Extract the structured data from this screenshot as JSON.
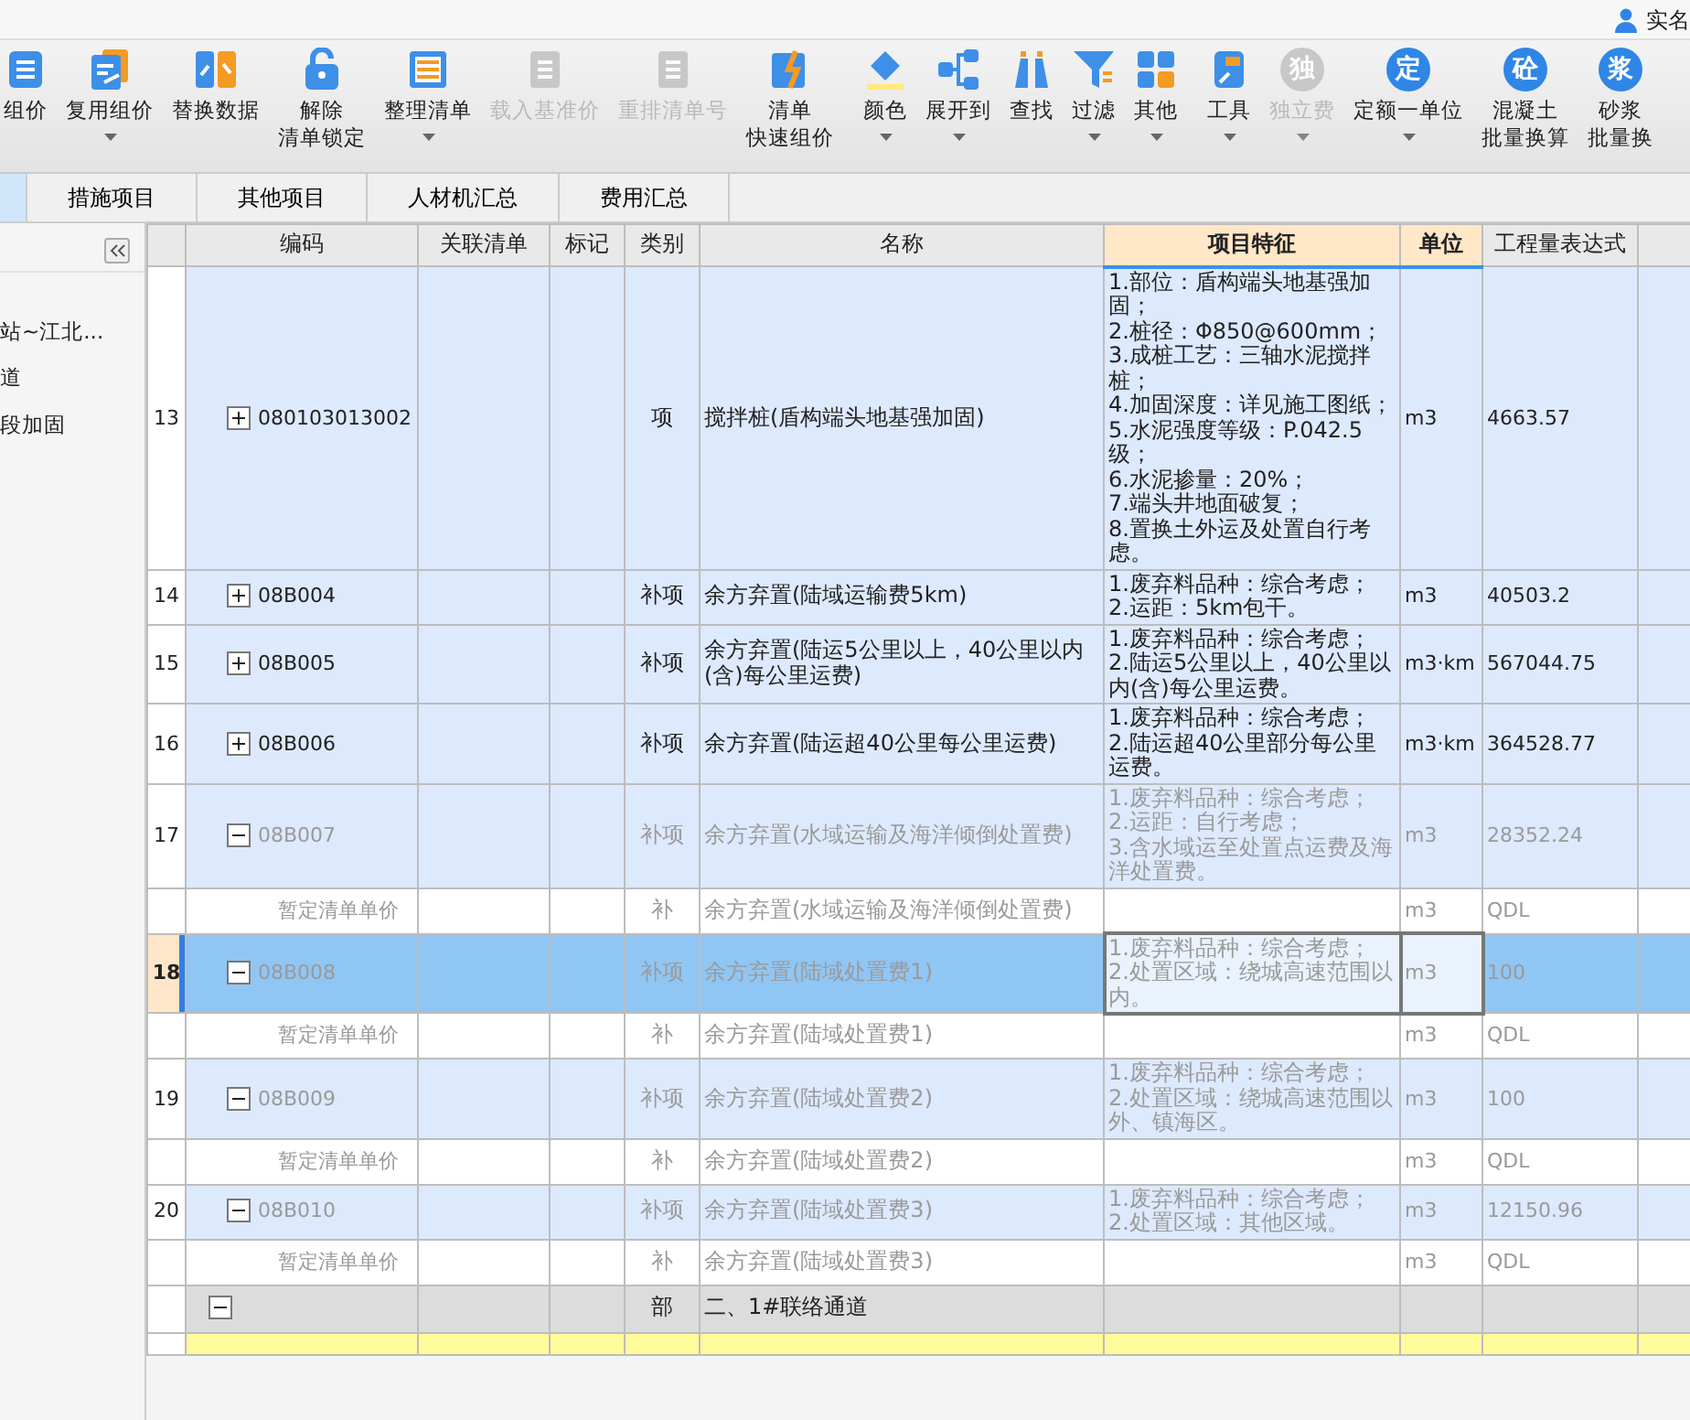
{
  "top_bar": {
    "user": "实名"
  },
  "toolbar": [
    {
      "label": [
        "组价"
      ],
      "dropdown": false,
      "disabled": false
    },
    {
      "label": [
        "复用组价"
      ],
      "dropdown": true,
      "disabled": false
    },
    {
      "label": [
        "替换数据"
      ],
      "dropdown": false,
      "disabled": false
    },
    {
      "label": [
        "解除",
        "清单锁定"
      ],
      "dropdown": false,
      "disabled": false
    },
    {
      "label": [
        "整理清单"
      ],
      "dropdown": true,
      "disabled": false
    },
    {
      "label": [
        "载入基准价"
      ],
      "dropdown": false,
      "disabled": true
    },
    {
      "label": [
        "重排清单号"
      ],
      "dropdown": false,
      "disabled": true
    },
    {
      "label": [
        "清单",
        "快速组价"
      ],
      "dropdown": false,
      "disabled": false
    },
    {
      "label": [
        "颜色"
      ],
      "dropdown": true,
      "disabled": false
    },
    {
      "label": [
        "展开到"
      ],
      "dropdown": true,
      "disabled": false
    },
    {
      "label": [
        "查找"
      ],
      "dropdown": false,
      "disabled": false
    },
    {
      "label": [
        "过滤"
      ],
      "dropdown": true,
      "disabled": false
    },
    {
      "label": [
        "其他"
      ],
      "dropdown": true,
      "disabled": false
    },
    {
      "label": [
        "工具"
      ],
      "dropdown": true,
      "disabled": false
    },
    {
      "label": [
        "独立费"
      ],
      "dropdown": true,
      "disabled": true,
      "glyph": "独"
    },
    {
      "label": [
        "定额一单位"
      ],
      "dropdown": true,
      "disabled": false,
      "glyph": "定"
    },
    {
      "label": [
        "混凝土",
        "批量换算"
      ],
      "dropdown": false,
      "disabled": false,
      "glyph": "砼"
    },
    {
      "label": [
        "砂浆",
        "批量换"
      ],
      "dropdown": false,
      "disabled": false,
      "glyph": "浆"
    }
  ],
  "tabs": [
    {
      "selected": true
    },
    {
      "label": "措施项目",
      "selected": false
    },
    {
      "label": "其他项目",
      "selected": false
    },
    {
      "label": "人材机汇总",
      "selected": false
    },
    {
      "label": "费用汇总",
      "selected": false
    }
  ],
  "sidebar": {
    "items": [
      {
        "label": "站~江北..."
      },
      {
        "label": "道"
      },
      {
        "label": "段加固"
      }
    ]
  },
  "table": {
    "columns": [
      {
        "selected": false
      },
      {
        "label": "编码",
        "selected": false
      },
      {
        "label": "关联清单",
        "selected": false
      },
      {
        "label": "标记",
        "selected": false
      },
      {
        "label": "类别",
        "selected": false
      },
      {
        "label": "名称",
        "selected": false
      },
      {
        "label": "项目特征",
        "selected": true
      },
      {
        "label": "单位",
        "selected": true
      },
      {
        "label": "工程量表达式",
        "selected": false
      },
      {
        "selected": false
      }
    ],
    "rows": [
      {
        "kind": "item",
        "number": "13",
        "code": "080103013002",
        "expanded": false,
        "dimmed": false,
        "selected": false,
        "category": "项",
        "name": "搅拌桩(盾构端头地基强加固)",
        "feature": "1.部位：盾构端头地基强加固；\n2.桩径：Φ850@600mm；\n3.成桩工艺：三轴水泥搅拌桩；\n4.加固深度：详见施工图纸；\n5.水泥强度等级：P.042.5级；\n6.水泥掺量：20%；\n7.端头井地面破复；\n8.置换土外运及处置自行考虑。",
        "unit": "m3",
        "quantity": "4663.57"
      },
      {
        "kind": "item",
        "number": "14",
        "code": "08B004",
        "expanded": false,
        "dimmed": false,
        "selected": false,
        "category": "补项",
        "name": "余方弃置(陆域运输费5km)",
        "feature": "1.废弃料品种：综合考虑；\n2.运距：5km包干。",
        "unit": "m3",
        "quantity": "40503.2"
      },
      {
        "kind": "item",
        "number": "15",
        "code": "08B005",
        "expanded": false,
        "dimmed": false,
        "selected": false,
        "category": "补项",
        "name": "余方弃置(陆运5公里以上，40公里以内(含)每公里运费)",
        "feature": "1.废弃料品种：综合考虑；\n2.陆运5公里以上，40公里以内(含)每公里运费。",
        "unit": "m3·km",
        "quantity": "567044.75"
      },
      {
        "kind": "item",
        "number": "16",
        "code": "08B006",
        "expanded": false,
        "dimmed": false,
        "selected": false,
        "category": "补项",
        "name": "余方弃置(陆运超40公里每公里运费)",
        "feature": "1.废弃料品种：综合考虑；\n2.陆运超40公里部分每公里运费。",
        "unit": "m3·km",
        "quantity": "364528.77"
      },
      {
        "kind": "item",
        "number": "17",
        "code": "08B007",
        "expanded": true,
        "dimmed": true,
        "selected": false,
        "category": "补项",
        "name": "余方弃置(水域运输及海洋倾倒处置费)",
        "feature": "1.废弃料品种：综合考虑；\n2.运距：自行考虑；\n3.含水域运至处置点运费及海洋处置费。",
        "unit": "m3",
        "quantity": "28352.24"
      },
      {
        "kind": "sub",
        "code": "暂定清单单价",
        "dimmed": true,
        "selected": false,
        "category": "补",
        "name": "余方弃置(水域运输及海洋倾倒处置费)",
        "unit": "m3",
        "quantity": "QDL"
      },
      {
        "kind": "item",
        "number": "18",
        "code": "08B008",
        "expanded": true,
        "dimmed": true,
        "selected": true,
        "category": "补项",
        "name": "余方弃置(陆域处置费1)",
        "feature": "1.废弃料品种：综合考虑；\n2.处置区域：绕城高速范围以内。",
        "unit": "m3",
        "quantity": "100"
      },
      {
        "kind": "sub",
        "code": "暂定清单单价",
        "dimmed": true,
        "selected": false,
        "category": "补",
        "name": "余方弃置(陆域处置费1)",
        "unit": "m3",
        "quantity": "QDL"
      },
      {
        "kind": "item",
        "number": "19",
        "code": "08B009",
        "expanded": true,
        "dimmed": true,
        "selected": false,
        "category": "补项",
        "name": "余方弃置(陆域处置费2)",
        "feature": "1.废弃料品种：综合考虑；\n2.处置区域：绕城高速范围以外、镇海区。",
        "unit": "m3",
        "quantity": "100"
      },
      {
        "kind": "sub",
        "code": "暂定清单单价",
        "dimmed": true,
        "selected": false,
        "category": "补",
        "name": "余方弃置(陆域处置费2)",
        "unit": "m3",
        "quantity": "QDL"
      },
      {
        "kind": "item",
        "number": "20",
        "code": "08B010",
        "expanded": true,
        "dimmed": true,
        "selected": false,
        "category": "补项",
        "name": "余方弃置(陆域处置费3)",
        "feature": "1.废弃料品种：综合考虑；\n2.处置区域：其他区域。",
        "unit": "m3",
        "quantity": "12150.96"
      },
      {
        "kind": "sub",
        "code": "暂定清单单价",
        "dimmed": true,
        "selected": false,
        "category": "补",
        "name": "余方弃置(陆域处置费3)",
        "unit": "m3",
        "quantity": "QDL"
      },
      {
        "kind": "part",
        "expanded": true,
        "dimmed": false,
        "selected": false,
        "category": "部",
        "name": "二、1#联络通道"
      },
      {
        "kind": "highlight"
      }
    ]
  }
}
